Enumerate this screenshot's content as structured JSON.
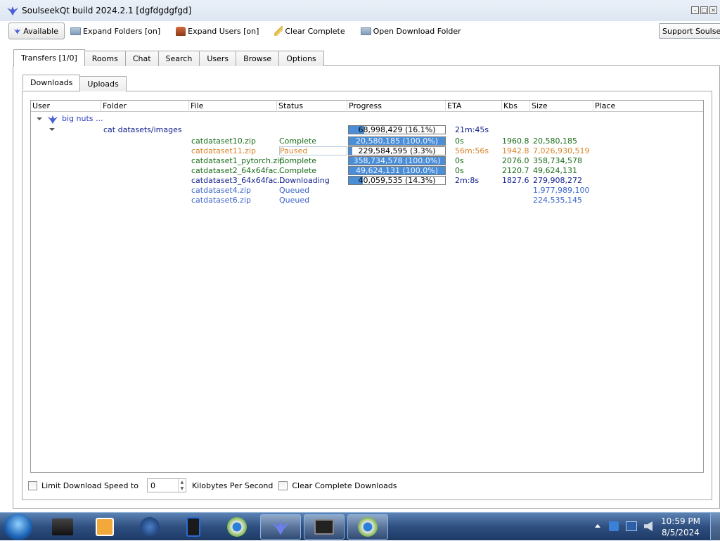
{
  "window": {
    "title": "SoulseekQt build 2024.2.1 [dgfdgdgfgd]",
    "controls": [
      "minimize",
      "restore",
      "close"
    ]
  },
  "toolbar": {
    "available_label": "Available",
    "expand_folders_label": "Expand Folders [on]",
    "expand_users_label": "Expand Users [on]",
    "clear_complete_label": "Clear Complete",
    "open_download_folder_label": "Open Download Folder",
    "support_label": "Support Soulseek"
  },
  "main_tabs": [
    "Transfers [1/0]",
    "Rooms",
    "Chat",
    "Search",
    "Users",
    "Browse",
    "Options"
  ],
  "sub_tabs": [
    "Downloads",
    "Uploads"
  ],
  "table": {
    "headers": [
      "User",
      "Folder",
      "File",
      "Status",
      "Progress",
      "ETA",
      "Kbs",
      "Size",
      "Place"
    ],
    "user": "big nuts ...",
    "folder": "cat datasets/images",
    "folder_progress": {
      "text": "68,998,429 (16.1%)",
      "fraction": 0.161,
      "eta": "21m:45s"
    },
    "rows": [
      {
        "file": "catdataset10.zip",
        "status": "Complete",
        "progress_text": "20,580,185 (100.0%)",
        "fraction": 1.0,
        "eta": "0s",
        "kbs": "1960.8",
        "size": "20,580,185",
        "state": "complete"
      },
      {
        "file": "catdataset11.zip",
        "status": "Paused",
        "progress_text": "229,584,595 (3.3%)",
        "fraction": 0.033,
        "eta": "56m:56s",
        "kbs": "1942.8",
        "size": "7,026,930,519",
        "state": "paused"
      },
      {
        "file": "catdataset1_pytorch.zip",
        "status": "Complete",
        "progress_text": "358,734,578 (100.0%)",
        "fraction": 1.0,
        "eta": "0s",
        "kbs": "2076.0",
        "size": "358,734,578",
        "state": "complete"
      },
      {
        "file": "catdataset2_64x64fac...",
        "status": "Complete",
        "progress_text": "49,624,131 (100.0%)",
        "fraction": 1.0,
        "eta": "0s",
        "kbs": "2120.7",
        "size": "49,624,131",
        "state": "complete"
      },
      {
        "file": "catdataset3_64x64fac...",
        "status": "Downloading",
        "progress_text": "40,059,535 (14.3%)",
        "fraction": 0.143,
        "eta": "2m:8s",
        "kbs": "1827.6",
        "size": "279,908,272",
        "state": "downloading"
      },
      {
        "file": "catdataset4.zip",
        "status": "Queued",
        "progress_text": "",
        "fraction": null,
        "eta": "",
        "kbs": "",
        "size": "1,977,989,100",
        "state": "queued"
      },
      {
        "file": "catdataset6.zip",
        "status": "Queued",
        "progress_text": "",
        "fraction": null,
        "eta": "",
        "kbs": "",
        "size": "224,535,145",
        "state": "queued"
      }
    ]
  },
  "footer": {
    "limit_speed_label": "Limit Download Speed to",
    "speed_value": "0",
    "kbps_label": "Kilobytes Per Second",
    "clear_complete_downloads_label": "Clear Complete Downloads"
  },
  "taskbar": {
    "clock_time": "10:59 PM",
    "clock_date": "8/5/2024"
  },
  "colors": {
    "complete": "#1a6d1a",
    "paused": "#d8842a",
    "downloading": "#0f1f8a",
    "queued": "#3c64c8",
    "progress_fill": "#4a8ed8"
  }
}
